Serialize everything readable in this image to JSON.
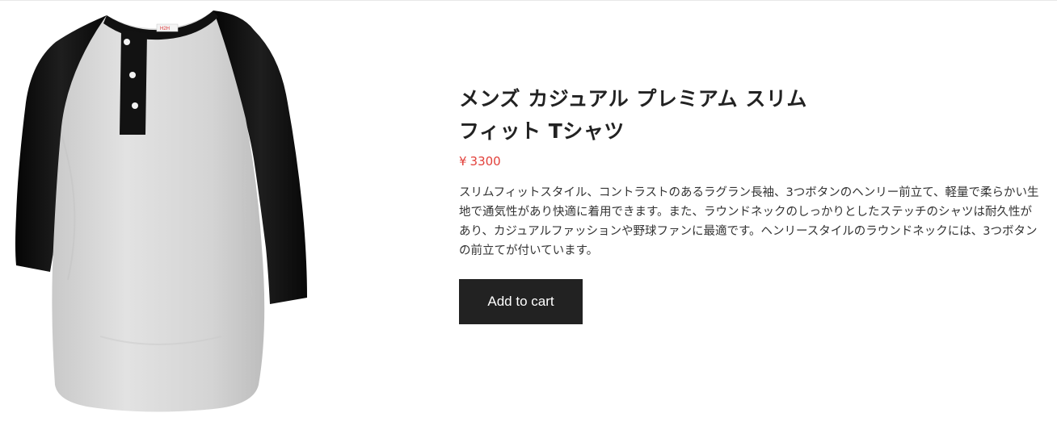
{
  "product": {
    "title": "メンズ カジュアル プレミアム スリム フィット Tシャツ",
    "price_currency": "¥",
    "price_value": "3300",
    "description": "スリムフィットスタイル、コントラストのあるラグラン長袖、3つボタンのヘンリー前立て、軽量で柔らかい生地で通気性があり快適に着用できます。また、ラウンドネックのしっかりとしたステッチのシャツは耐久性があり、カジュアルファッションや野球ファンに最適です。ヘンリースタイルのラウンドネックには、3つボタンの前立てが付いています。",
    "add_to_cart_label": "Add to cart",
    "image_label_text": "H2H",
    "colors": {
      "price": "#e2403a",
      "button": "#222222",
      "body_fabric": "#d9d9d9",
      "sleeve_fabric": "#121212"
    }
  }
}
